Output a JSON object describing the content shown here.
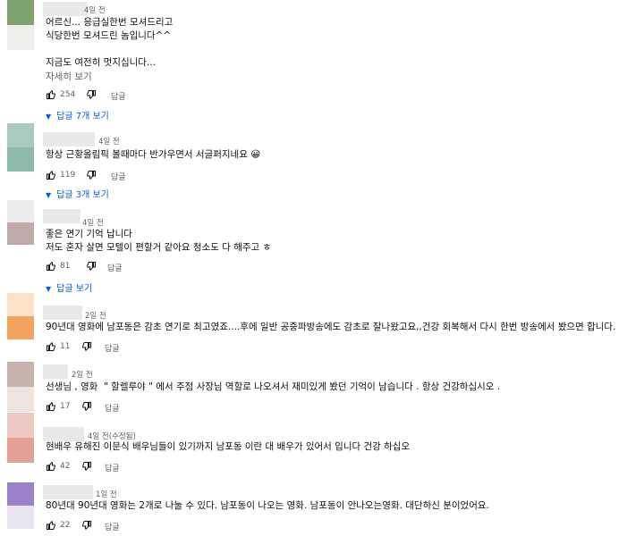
{
  "comments": [
    {
      "time": "4일 전",
      "text": "어르신... 응급실한번 모셔드리고\n식당한번 모셔드린 놈입니다^^\n\n지금도 여전히 멋지십니다...",
      "more_label": "자세히 보기",
      "likes": "254",
      "reply_label": "답글",
      "replies_label": "답글 7개 보기"
    },
    {
      "time": "4일 전",
      "text": "항상 근황올림픽 볼때마다 반가우면서 서글퍼지네요 😀",
      "likes": "119",
      "reply_label": "답글",
      "replies_label": "답글 3개 보기"
    },
    {
      "time": "4일 전",
      "text": "좋은 연기 기억 납니다\n저도 혼자 살면 모텔이 편할거 같아요 청소도 다 해주고 ㅎ",
      "likes": "81",
      "reply_label": "답글",
      "replies_label": "답글 보기"
    },
    {
      "time": "2일 전",
      "text": "90년대 영화에 남포동은 감초 연기로 최고였죠....후에 일반 공중파방송에도 감초로 잘나왔고요,,건강 회복해서 다시 한번 방송에서 봤으면 합니다.",
      "likes": "11",
      "reply_label": "답글"
    },
    {
      "time": "2일 전",
      "text": "선생님 , 영화  \" 할렐루야 \" 에서 주점 사장님 역할로 나오셔서 재미있게 봤던 기억이 남습니다 . 항상 건강하십시오 .",
      "likes": "17",
      "reply_label": "답글"
    },
    {
      "time": "4일 전(수정됨)",
      "text": "현배우 유해진 이문식 배우님들이 있기까지 남포동 이란 대 배우가 있어서 입니다 건강 하십오",
      "likes": "42",
      "reply_label": "답글"
    },
    {
      "time": "1일 전",
      "text": "80년대 90년대 영화는 2개로 나눌 수 있다. 남포동이 나오는 영화. 남포동이 안나오는영화. 대단하신 분이었어요.",
      "likes": "22",
      "reply_label": "답글"
    }
  ],
  "colors": {
    "link_blue": "#065fd4",
    "meta_gray": "#606060",
    "text": "#0f0f0f"
  },
  "icons": {
    "like": "thumbs-up-icon",
    "dislike": "thumbs-down-icon",
    "replies_caret": "caret-down-icon"
  }
}
